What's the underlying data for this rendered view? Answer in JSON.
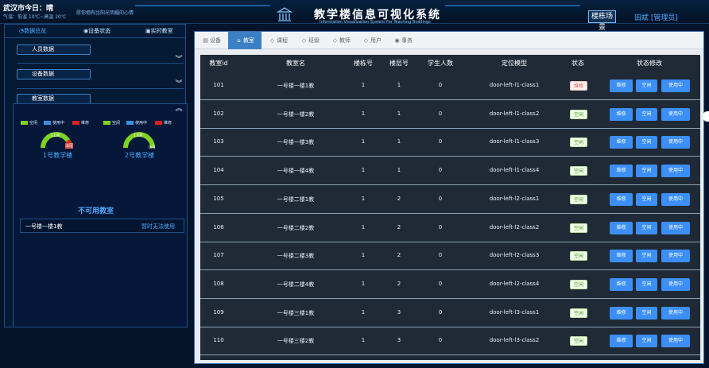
{
  "header": {
    "city_label": "武汉市今日：晴",
    "weather": "气温：低温 10℃~高温 20℃",
    "marquee": "愿你拥有比阳光明媚的心情",
    "title": "教学楼信息可视化系统",
    "subtitle": "Information Visualization System For Teaching Buildings",
    "nav_scene": "楼栋场景",
    "nav_user": "田斌 [管理员]"
  },
  "left_panel": {
    "tabs": [
      "数据总览",
      "设备状态",
      "实时教室"
    ],
    "active_tab": 0,
    "sections": [
      "人员数据",
      "设备数据",
      "教室数据"
    ],
    "legend": [
      "空闲",
      "使用中",
      "维修"
    ],
    "legend_colors": [
      "#7ed321",
      "#3b8fe4",
      "#e02020"
    ],
    "buildings": [
      {
        "name": "1号教学楼",
        "free": "11间",
        "busy": "0间",
        "repair": "1间"
      },
      {
        "name": "2号教学楼",
        "free": "12间",
        "busy": "0间",
        "repair": ""
      }
    ],
    "unavailable_title": "不可用教室",
    "unavailable": [
      {
        "name": "一号楼一楼1教",
        "status": "暂时无法使用"
      }
    ]
  },
  "main": {
    "tabs": [
      {
        "icon": "document-icon",
        "glyph": "▤",
        "label": "设备"
      },
      {
        "icon": "home-icon",
        "glyph": "⌂",
        "label": "教室"
      },
      {
        "icon": "cube-icon",
        "glyph": "◇",
        "label": "课程"
      },
      {
        "icon": "cube-icon",
        "glyph": "◇",
        "label": "班级"
      },
      {
        "icon": "cube-icon",
        "glyph": "◇",
        "label": "教师"
      },
      {
        "icon": "cube-icon",
        "glyph": "◇",
        "label": "用户"
      },
      {
        "icon": "eye-icon",
        "glyph": "◉",
        "label": "事务"
      }
    ],
    "active_tab": 1,
    "columns": [
      "教室id",
      "教室名",
      "楼栋号",
      "楼层号",
      "学生人数",
      "定位模型",
      "状态",
      "状态修改"
    ],
    "action_labels": [
      "维修",
      "空闲",
      "使用中"
    ],
    "rows": [
      {
        "id": "101",
        "name": "一号楼一楼1教",
        "building": "1",
        "floor": "1",
        "students": "0",
        "model": "door-left-l1-class1",
        "status": "维修",
        "status_type": "repair"
      },
      {
        "id": "102",
        "name": "一号楼一楼2教",
        "building": "1",
        "floor": "1",
        "students": "0",
        "model": "door-left-l1-class2",
        "status": "空闲",
        "status_type": "free"
      },
      {
        "id": "103",
        "name": "一号楼一楼3教",
        "building": "1",
        "floor": "1",
        "students": "0",
        "model": "door-left-l1-class3",
        "status": "空闲",
        "status_type": "free"
      },
      {
        "id": "104",
        "name": "一号楼一楼4教",
        "building": "1",
        "floor": "1",
        "students": "0",
        "model": "door-left-l1-class4",
        "status": "空闲",
        "status_type": "free"
      },
      {
        "id": "105",
        "name": "一号楼二楼1教",
        "building": "1",
        "floor": "2",
        "students": "0",
        "model": "door-left-l2-class1",
        "status": "空闲",
        "status_type": "free"
      },
      {
        "id": "106",
        "name": "一号楼二楼2教",
        "building": "1",
        "floor": "2",
        "students": "0",
        "model": "door-left-l2-class2",
        "status": "空闲",
        "status_type": "free"
      },
      {
        "id": "107",
        "name": "一号楼二楼3教",
        "building": "1",
        "floor": "2",
        "students": "0",
        "model": "door-left-l2-class3",
        "status": "空闲",
        "status_type": "free"
      },
      {
        "id": "108",
        "name": "一号楼二楼4教",
        "building": "1",
        "floor": "2",
        "students": "0",
        "model": "door-left-l2-class4",
        "status": "空闲",
        "status_type": "free"
      },
      {
        "id": "109",
        "name": "一号楼三楼1教",
        "building": "1",
        "floor": "3",
        "students": "0",
        "model": "door-left-l3-class1",
        "status": "空闲",
        "status_type": "free"
      },
      {
        "id": "110",
        "name": "一号楼三楼2教",
        "building": "1",
        "floor": "3",
        "students": "0",
        "model": "door-left-l3-class2",
        "status": "空闲",
        "status_type": "free"
      }
    ]
  }
}
